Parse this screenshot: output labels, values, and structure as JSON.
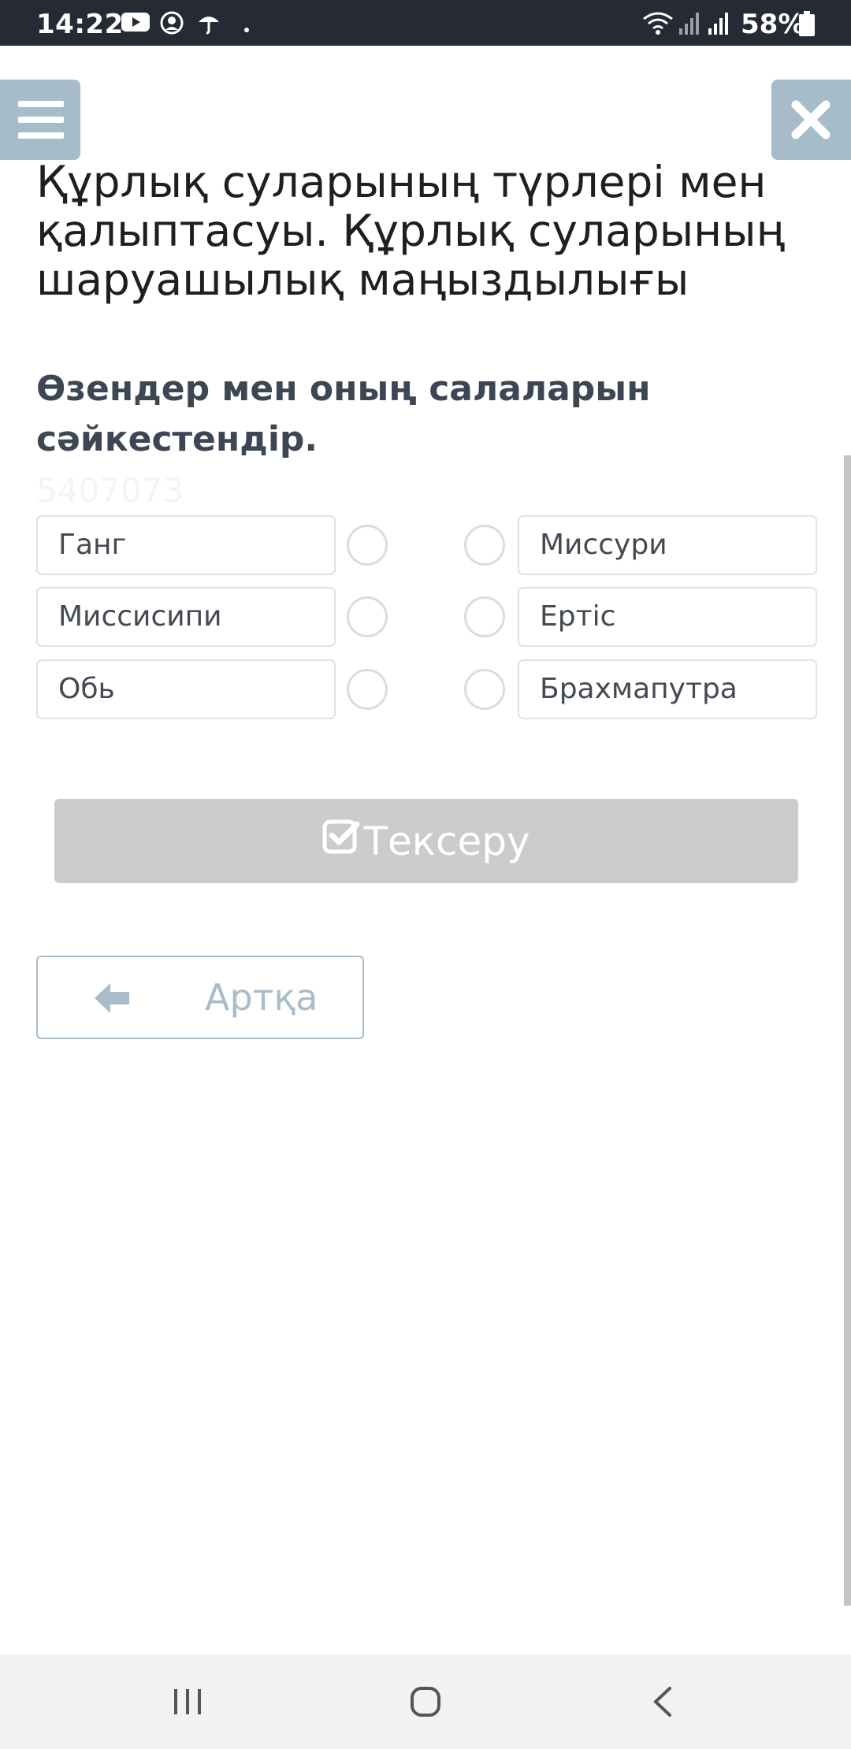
{
  "status_bar": {
    "time": "14:22",
    "battery": "58%",
    "icons": [
      "youtube-icon",
      "account-icon",
      "umbrella-icon",
      "dot-icon",
      "wifi-icon",
      "signal-icon",
      "signal-icon",
      "battery-icon"
    ]
  },
  "header": {
    "menu_icon": "hamburger-menu-icon",
    "close_icon": "close-x-icon"
  },
  "page": {
    "title": "Құрлық суларының түрлері мен қалыптасуы. Құрлық суларының шаруашылық маңыздылығы",
    "instruction": "Өзендер мен оның салаларын сәйкестендір.",
    "task_id": "5407073"
  },
  "matching": {
    "left": [
      "Ганг",
      "Миссисипи",
      "Обь"
    ],
    "right": [
      "Миссури",
      "Ертіс",
      "Брахмапутра"
    ]
  },
  "actions": {
    "check_label": "Тексеру",
    "check_icon": "check-square-icon",
    "back_label": "Артқа",
    "back_icon": "arrow-left-icon"
  },
  "colors": {
    "status_bar_bg": "#262a35",
    "accent": "#a7bccb",
    "check_button_bg": "#cbcbcb",
    "instruction_text": "#3c4654"
  },
  "nav_bar": {
    "icons": [
      "recent-apps-icon",
      "home-icon",
      "back-icon"
    ]
  }
}
